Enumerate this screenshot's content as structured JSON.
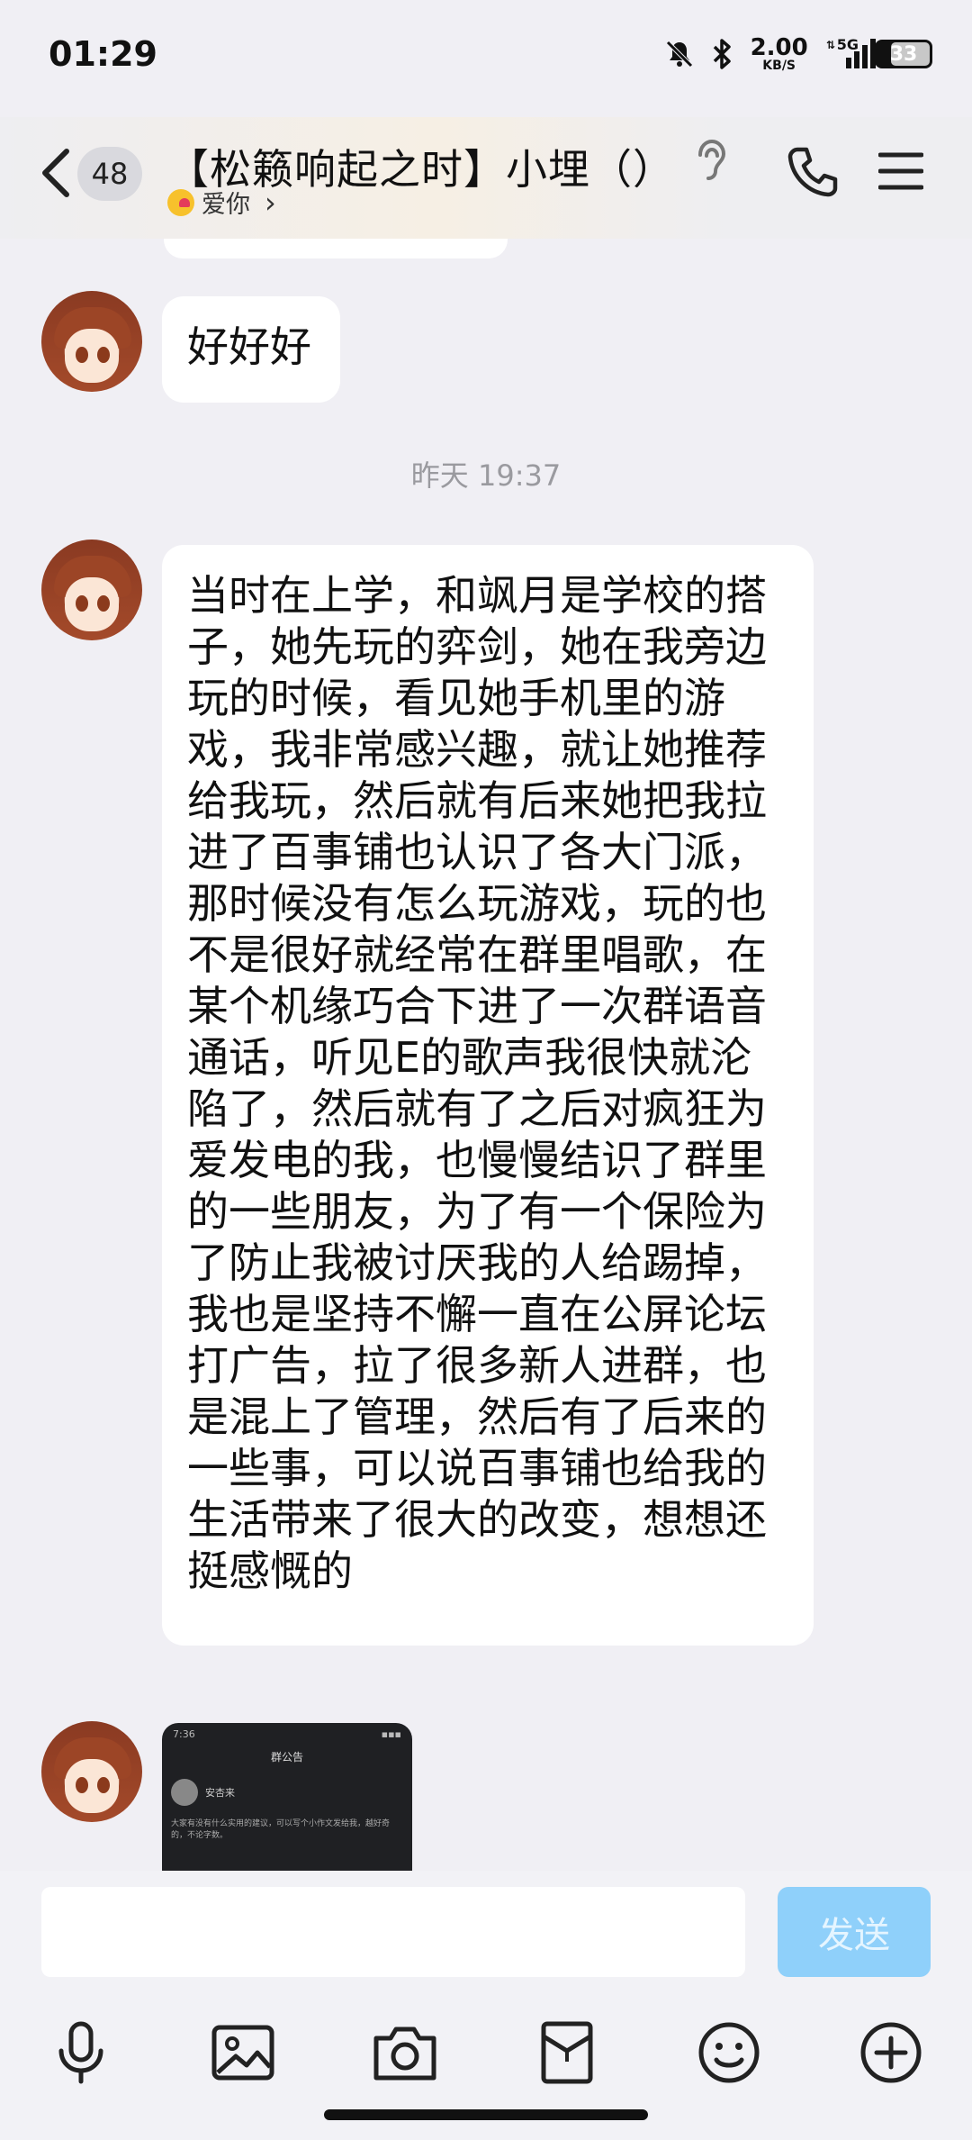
{
  "status_bar": {
    "time": "01:29",
    "net_speed": "2.00",
    "net_unit": "KB/S",
    "network": "5G",
    "battery": "33"
  },
  "header": {
    "unread_count": "48",
    "title": "【松籁响起之时】小埋（）",
    "subtitle": "爱你",
    "subtitle_chevron": "›"
  },
  "messages": [
    {
      "type": "text",
      "text": "好好好"
    },
    {
      "type": "timestamp",
      "text": "昨天 19:37"
    },
    {
      "type": "text",
      "text": "当时在上学，和飒月是学校的搭子，她先玩的弈剑，她在我旁边玩的时候，看见她手机里的游戏，我非常感兴趣，就让她推荐给我玩，然后就有后来她把我拉进了百事铺也认识了各大门派，那时候没有怎么玩游戏，玩的也不是很好就经常在群里唱歌，在某个机缘巧合下进了一次群语音通话，听见E的歌声我很快就沦陷了，然后就有了之后对疯狂为爱发电的我，也慢慢结识了群里的一些朋友，为了有一个保险为了防止我被讨厌我的人给踢掉，我也是坚持不懈一直在公屏论坛打广告，拉了很多新人进群，也是混上了管理，然后有了后来的一些事，可以说百事铺也给我的生活带来了很大的改变，想想还挺感慨的"
    },
    {
      "type": "image",
      "thumb_time": "7:36",
      "thumb_title": "群公告",
      "thumb_name": "安杏来",
      "thumb_text": "大家有没有什么实用的建议，可以写个小作文发给我，越好奇的，不论字数。"
    }
  ],
  "input": {
    "placeholder": "",
    "send_label": "发送"
  },
  "toolbar": {
    "icons": [
      "microphone-icon",
      "image-icon",
      "camera-icon",
      "red-packet-icon",
      "emoji-icon",
      "plus-icon"
    ]
  },
  "colors": {
    "background": "#f0eff4",
    "bubble": "#ffffff",
    "send_button": "#8fd0fa"
  }
}
